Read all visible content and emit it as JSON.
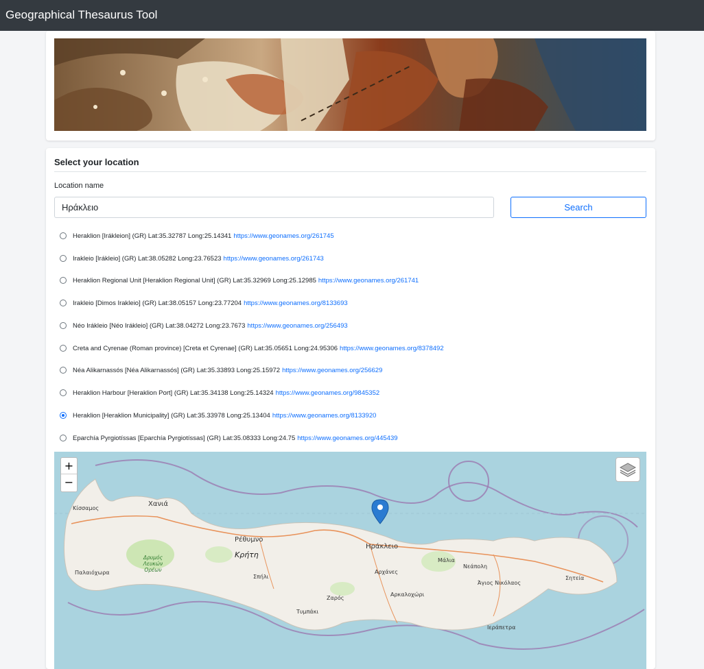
{
  "app": {
    "title": "Geographical Thesaurus Tool"
  },
  "banner": {
    "alt": "Antique map globe"
  },
  "form": {
    "section_title": "Select your location",
    "field_label": "Location name",
    "input_value": "Ηράκλειο",
    "search_label": "Search"
  },
  "results": [
    {
      "text": "Heraklion [Irákleion] (GR) Lat:35.32787 Long:25.14341",
      "link": "https://www.geonames.org/261745",
      "checked": false
    },
    {
      "text": "Irakleio [Irákleio] (GR) Lat:38.05282 Long:23.76523",
      "link": "https://www.geonames.org/261743",
      "checked": false
    },
    {
      "text": "Heraklion Regional Unit [Heraklion Regional Unit] (GR) Lat:35.32969 Long:25.12985",
      "link": "https://www.geonames.org/261741",
      "checked": false
    },
    {
      "text": "Irakleio [Dimos Irakleio] (GR) Lat:38.05157 Long:23.77204",
      "link": "https://www.geonames.org/8133693",
      "checked": false
    },
    {
      "text": "Néo Irákleio [Néo Irákleio] (GR) Lat:38.04272 Long:23.7673",
      "link": "https://www.geonames.org/256493",
      "checked": false
    },
    {
      "text": "Creta and Cyrenae (Roman province) [Creta et Cyrenae] (GR) Lat:35.05651 Long:24.95306",
      "link": "https://www.geonames.org/8378492",
      "checked": false
    },
    {
      "text": "Néa Alikarnassós [Néa Alikarnassós] (GR) Lat:35.33893 Long:25.15972",
      "link": "https://www.geonames.org/256629",
      "checked": false
    },
    {
      "text": "Heraklion Harbour [Heraklion Port] (GR) Lat:35.34138 Long:25.14324",
      "link": "https://www.geonames.org/9845352",
      "checked": false
    },
    {
      "text": "Heraklion [Heraklion Municipality] (GR) Lat:35.33978 Long:25.13404",
      "link": "https://www.geonames.org/8133920",
      "checked": true
    },
    {
      "text": "Eparchía Pyrgiotíssas [Eparchía Pyrgiotíssas] (GR) Lat:35.08333 Long:24.75",
      "link": "https://www.geonames.org/445439",
      "checked": false
    }
  ],
  "map": {
    "zoom_in": "+",
    "zoom_out": "−",
    "labels": {
      "kissamos": "Κίσσαμος",
      "chania": "Χανιά",
      "rethymno": "Ρέθυμνο",
      "kriti": "Κρήτη",
      "heraklion": "Ηράκλειο",
      "malia": "Μάλια",
      "neapoli": "Νεάπολη",
      "agios_nikolaos": "Άγιος Νικόλαος",
      "siteia": "Σητεία",
      "archanes": "Αρχάνες",
      "arkalochori": "Αρκαλοχώρι",
      "zaros": "Ζαρός",
      "tympaki": "Τυμπάκι",
      "ierapetra": "Ιεράπετρα",
      "spili": "Σπήλι",
      "palaiochora": "Παλαιόχωρα",
      "park": "Δρυμός Λευκών Ορέων"
    },
    "colors": {
      "sea": "#aad3df",
      "land": "#f2efe9",
      "road": "#e8925a",
      "boundary": "#9b7bb0"
    }
  }
}
